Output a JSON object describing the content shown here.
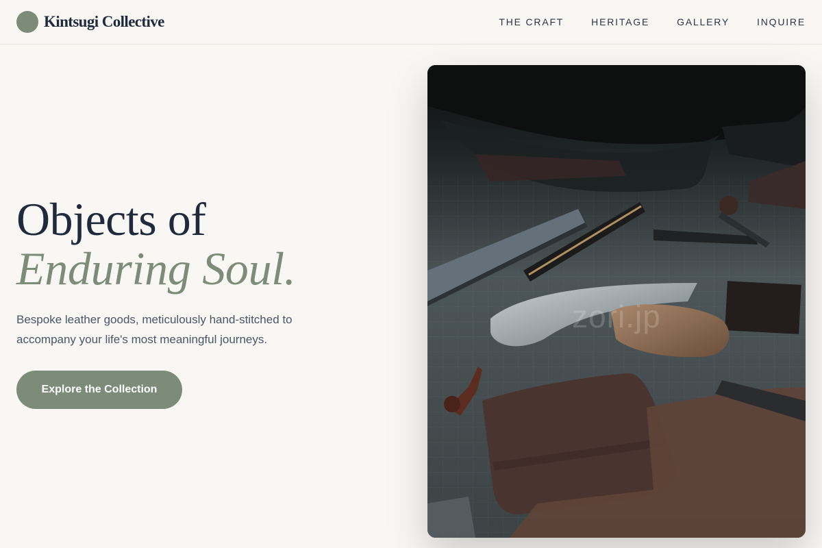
{
  "brand": {
    "name": "Kintsugi Collective",
    "logo_color": "#7c8c79"
  },
  "nav": {
    "items": [
      {
        "label": "THE CRAFT"
      },
      {
        "label": "HERITAGE"
      },
      {
        "label": "GALLERY"
      },
      {
        "label": "INQUIRE"
      }
    ]
  },
  "hero": {
    "headline_line1": "Objects of",
    "headline_line2": "Enduring Soul.",
    "description": "Bespoke leather goods, meticulously hand-stitched to accompany your life's most meaningful journeys.",
    "cta_label": "Explore the Collection"
  },
  "photo": {
    "watermark": "zori.jp",
    "alt": "leather craft tools on a cutting mat"
  },
  "colors": {
    "background": "#f9f7f3",
    "accent_sage": "#7c8c79",
    "text_dark": "#1f2a3d",
    "text_muted": "#4a5568"
  }
}
